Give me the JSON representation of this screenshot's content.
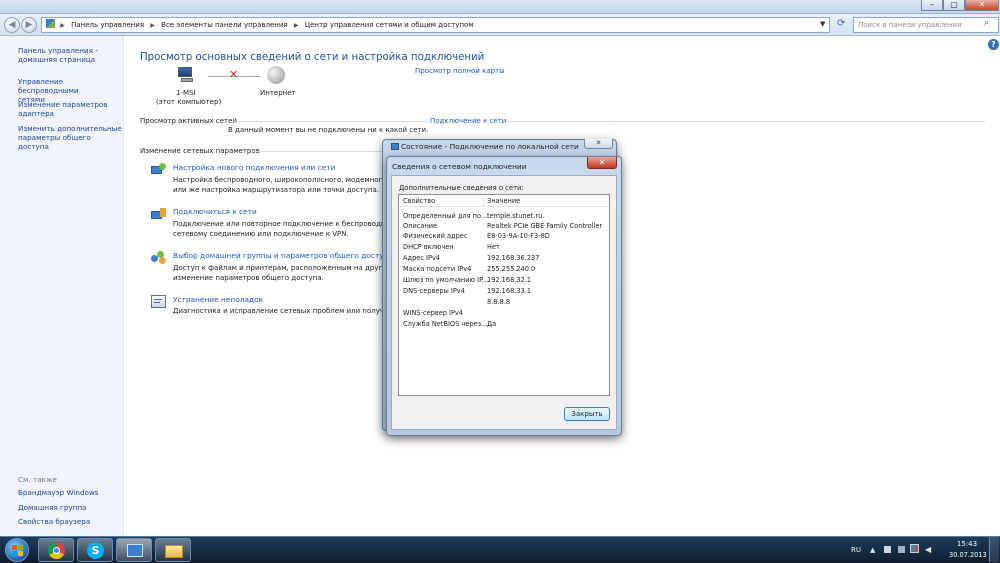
{
  "window": {
    "minimize": "–",
    "maximize": "▢",
    "close": "✕"
  },
  "nav": {
    "back": "◀",
    "forward": "▶",
    "breadcrumbs": [
      "Панель управления",
      "Все элементы панели управления",
      "Центр управления сетями и общим доступом"
    ],
    "search_placeholder": "Поиск в панели управления"
  },
  "sidebar": {
    "items": [
      "Панель управления -\nдомашняя страница",
      "Управление беспроводными\nсетями",
      "Изменение параметров\nадаптера",
      "Изменить дополнительные\nпараметры общего доступа"
    ],
    "see_also": "См. также",
    "see_also_items": [
      "Брандмауэр Windows",
      "Домашняя группа",
      "Свойства браузера"
    ]
  },
  "main": {
    "title": "Просмотр основных сведений о сети и настройка подключений",
    "full_map": "Просмотр полной карты",
    "computer_name": "1-MSI",
    "computer_sub": "(этот компьютер)",
    "internet": "Интернет",
    "active_networks_label": "Просмотр активных сетей",
    "connect_link": "Подключение к сети",
    "not_connected": "В данный момент вы не подключены ни к какой сети.",
    "change_settings_label": "Изменение сетевых параметров",
    "tasks": [
      {
        "title": "Настройка нового подключения или сети",
        "desc": "Настройка беспроводного, широкополосного, модемного,\nили же настройка маршрутизатора или точки доступа."
      },
      {
        "title": "Подключиться к сети",
        "desc": "Подключение или повторное подключение к беспроводн\nсетевому соединению или подключение к VPN."
      },
      {
        "title": "Выбор домашней группы и параметров общего доступа",
        "desc": "Доступ к файлам и принтерам, расположенным на других с\nизменение параметров общего доступа."
      },
      {
        "title": "Устранение неполадок",
        "desc": "Диагностика и исправление сетевых проблем или получени"
      }
    ],
    "help": "?"
  },
  "status_dialog": {
    "title": "Состояние - Подключение по локальной сети",
    "close": "✕"
  },
  "details_dialog": {
    "title": "Сведения о сетевом подключении",
    "close": "✕",
    "section": "Дополнительные сведения о сети:",
    "col_property": "Свойство",
    "col_value": "Значение",
    "rows": [
      [
        "Определенный для по...",
        "temple.stunet.ru."
      ],
      [
        "Описание",
        "Realtek PCIe GBE Family Controller"
      ],
      [
        "Физический адрес",
        "E8-03-9A-10-F3-8D"
      ],
      [
        "DHCP включен",
        "Нет"
      ],
      [
        "Адрес IPv4",
        "192.168.36.237"
      ],
      [
        "Маска подсети IPv4",
        "255.255.240.0"
      ],
      [
        "Шлюз по умолчанию IP...",
        "192.168.32.1"
      ],
      [
        "DNS-серверы IPv4",
        "192.168.33.1"
      ],
      [
        "",
        "8.8.8.8"
      ],
      [
        "WINS-сервер IPv4",
        ""
      ],
      [
        "Служба NetBIOS через...",
        "Да"
      ]
    ],
    "close_button": "Закрыть"
  },
  "taskbar": {
    "lang": "RU",
    "time": "15:43",
    "date": "30.07.2013"
  }
}
